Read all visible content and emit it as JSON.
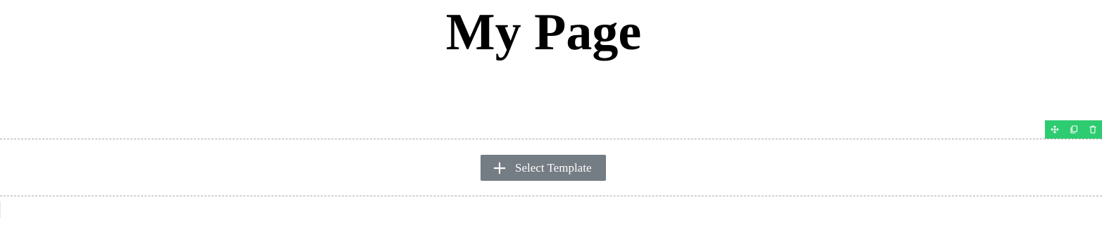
{
  "page": {
    "title": "My Page"
  },
  "section": {
    "select_template_label": "Select Template",
    "select_template_icon": "plus-icon"
  },
  "toolbar": {
    "accent_color": "#2ecc71",
    "tools": [
      {
        "name": "move",
        "icon": "move-icon"
      },
      {
        "name": "clone",
        "icon": "clone-icon"
      },
      {
        "name": "delete",
        "icon": "trash-icon"
      }
    ]
  },
  "colors": {
    "button_background": "#747c84",
    "section_border": "#a9a9a9"
  }
}
